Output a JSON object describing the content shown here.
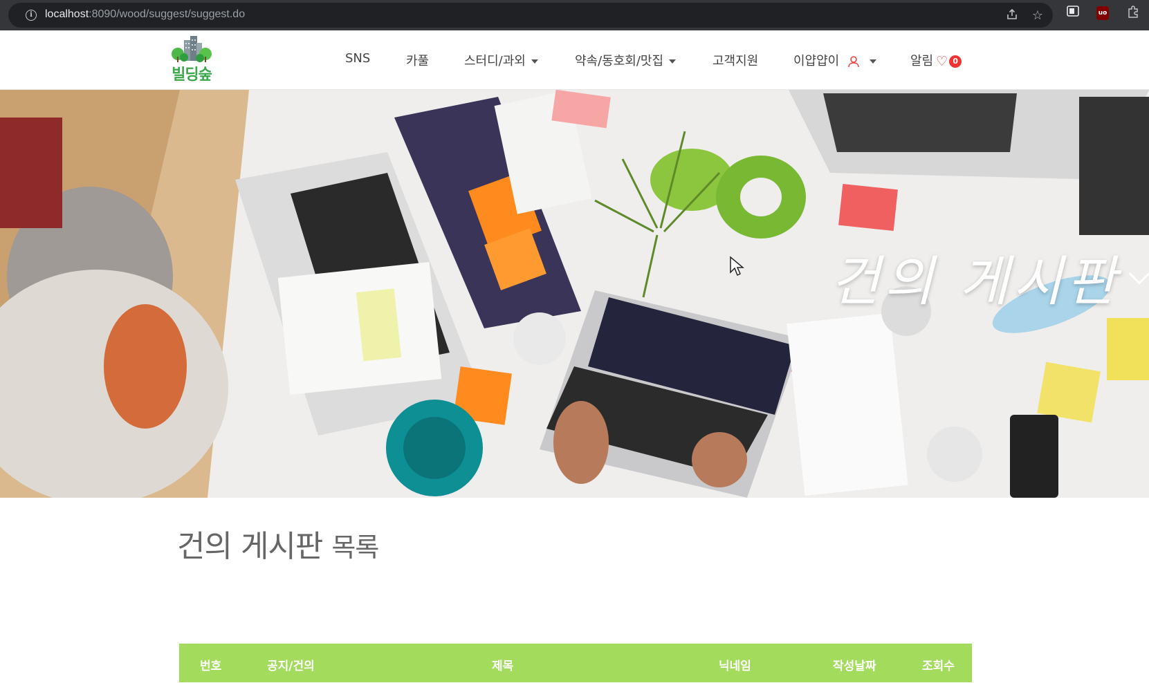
{
  "browser": {
    "url_host": "localhost",
    "url_path": ":8090/wood/suggest/suggest.do"
  },
  "nav": {
    "logo_text": "빌딩숲",
    "items": [
      {
        "label": "SNS"
      },
      {
        "label": "카풀"
      },
      {
        "label": "스터디/과외"
      },
      {
        "label": "약속/동호회/맛집"
      },
      {
        "label": "고객지원"
      },
      {
        "label": "이얍얍이"
      },
      {
        "label": "알림"
      }
    ],
    "notification_count": "0"
  },
  "hero": {
    "title": "건의 게시판"
  },
  "page": {
    "title_main": "건의 게시판",
    "title_sub": "목록"
  },
  "table": {
    "headers": [
      "번호",
      "공지/건의",
      "제목",
      "닉네임",
      "작성날짜",
      "조회수"
    ]
  },
  "colors": {
    "accent_green": "#a3dc5c",
    "logo_green": "#3aa84a",
    "badge_red": "#e33333"
  }
}
